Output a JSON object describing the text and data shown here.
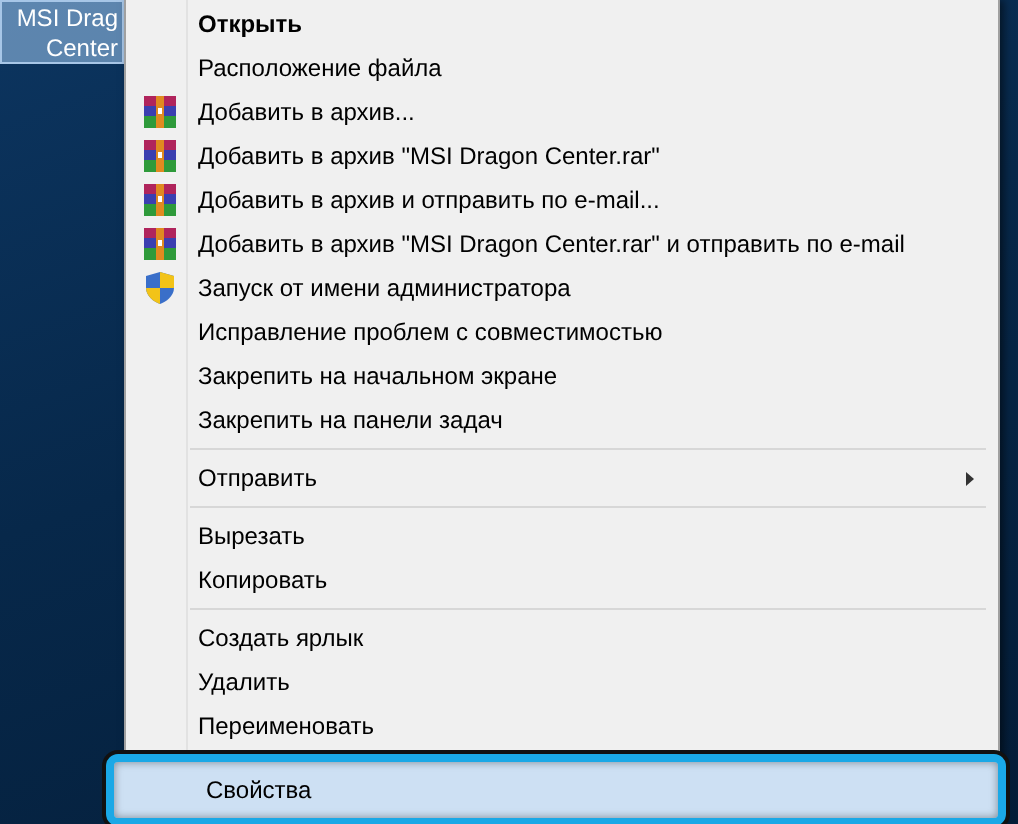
{
  "desktop_icon": {
    "label_lines": [
      "MSI Drag",
      "Center"
    ],
    "selected": true
  },
  "context_menu": {
    "items": [
      {
        "kind": "command",
        "label": "Открыть",
        "default": true,
        "selected": false
      },
      {
        "kind": "command",
        "label": "Расположение файла",
        "selected": false
      },
      {
        "kind": "archive",
        "label": "Добавить в архив...",
        "selected": false
      },
      {
        "kind": "archive",
        "label": "Добавить в архив \"MSI Dragon Center.rar\"",
        "selected": false
      },
      {
        "kind": "archive",
        "label": "Добавить в архив и отправить по e-mail...",
        "selected": false
      },
      {
        "kind": "archive",
        "label": "Добавить в архив \"MSI Dragon Center.rar\" и отправить по e-mail",
        "selected": false
      },
      {
        "kind": "shield",
        "label": "Запуск от имени администратора",
        "selected": false
      },
      {
        "kind": "command",
        "label": "Исправление проблем с совместимостью",
        "selected": false
      },
      {
        "kind": "command",
        "label": "Закрепить на начальном экране",
        "selected": false
      },
      {
        "kind": "command",
        "label": "Закрепить на панели задач",
        "selected": false
      },
      {
        "kind": "separator"
      },
      {
        "kind": "command",
        "label": "Отправить",
        "submenu": true,
        "selected": false
      },
      {
        "kind": "separator"
      },
      {
        "kind": "command",
        "label": "Вырезать",
        "selected": false
      },
      {
        "kind": "command",
        "label": "Копировать",
        "selected": false
      },
      {
        "kind": "separator"
      },
      {
        "kind": "command",
        "label": "Создать ярлык",
        "selected": false
      },
      {
        "kind": "command",
        "label": "Удалить",
        "selected": false
      },
      {
        "kind": "command",
        "label": "Переименовать",
        "selected": false
      },
      {
        "kind": "command",
        "label": "Свойства",
        "selected": true
      }
    ]
  }
}
